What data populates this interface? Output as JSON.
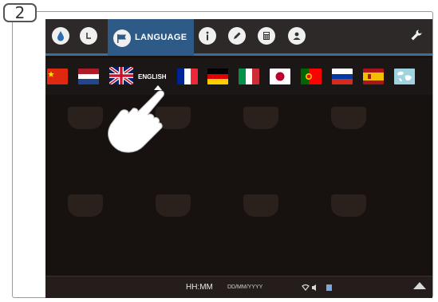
{
  "step_badge": "2",
  "toolbar": {
    "language_label": "LANGUAGE",
    "icons": [
      "water-drop-icon",
      "clock-icon",
      "flag-icon",
      "info-icon",
      "pencil-icon",
      "calculator-icon",
      "user-icon",
      "wrench-icon"
    ],
    "active_color": "#2d5a86"
  },
  "languages": {
    "selected_label": "ENGLISH",
    "flags": [
      "china",
      "netherlands",
      "united-kingdom",
      "france",
      "germany",
      "italy",
      "japan",
      "portugal",
      "russia",
      "spain",
      "global"
    ]
  },
  "status_bar": {
    "time": "HH:MM",
    "date": "DD/MM/YYYY"
  }
}
